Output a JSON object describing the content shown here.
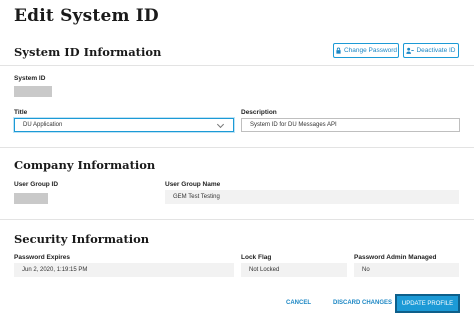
{
  "page": {
    "title": "Edit System ID"
  },
  "system_id_section": {
    "title": "System ID Information",
    "change_password_label": "Change Password",
    "deactivate_id_label": "Deactivate ID",
    "system_id_label": "System ID",
    "title_label": "Title",
    "title_value": "DU Application",
    "description_label": "Description",
    "description_value": "System ID for DU Messages API"
  },
  "company_section": {
    "title": "Company Information",
    "user_group_id_label": "User Group ID",
    "user_group_name_label": "User Group Name",
    "user_group_name_value": "GEM Test Testing"
  },
  "security_section": {
    "title": "Security Information",
    "password_expires_label": "Password Expires",
    "password_expires_value": "Jun 2, 2020, 1:19:15 PM",
    "lock_flag_label": "Lock Flag",
    "lock_flag_value": "Not Locked",
    "password_admin_managed_label": "Password Admin Managed",
    "password_admin_managed_value": "No"
  },
  "footer": {
    "cancel_label": "CANCEL",
    "discard_label": "DISCARD CHANGES",
    "update_label": "UPDATE PROFILE"
  },
  "colors": {
    "accent": "#1c9ad6",
    "accent_dark": "#0e5f8a",
    "readonly_bg": "#f2f2f2"
  }
}
